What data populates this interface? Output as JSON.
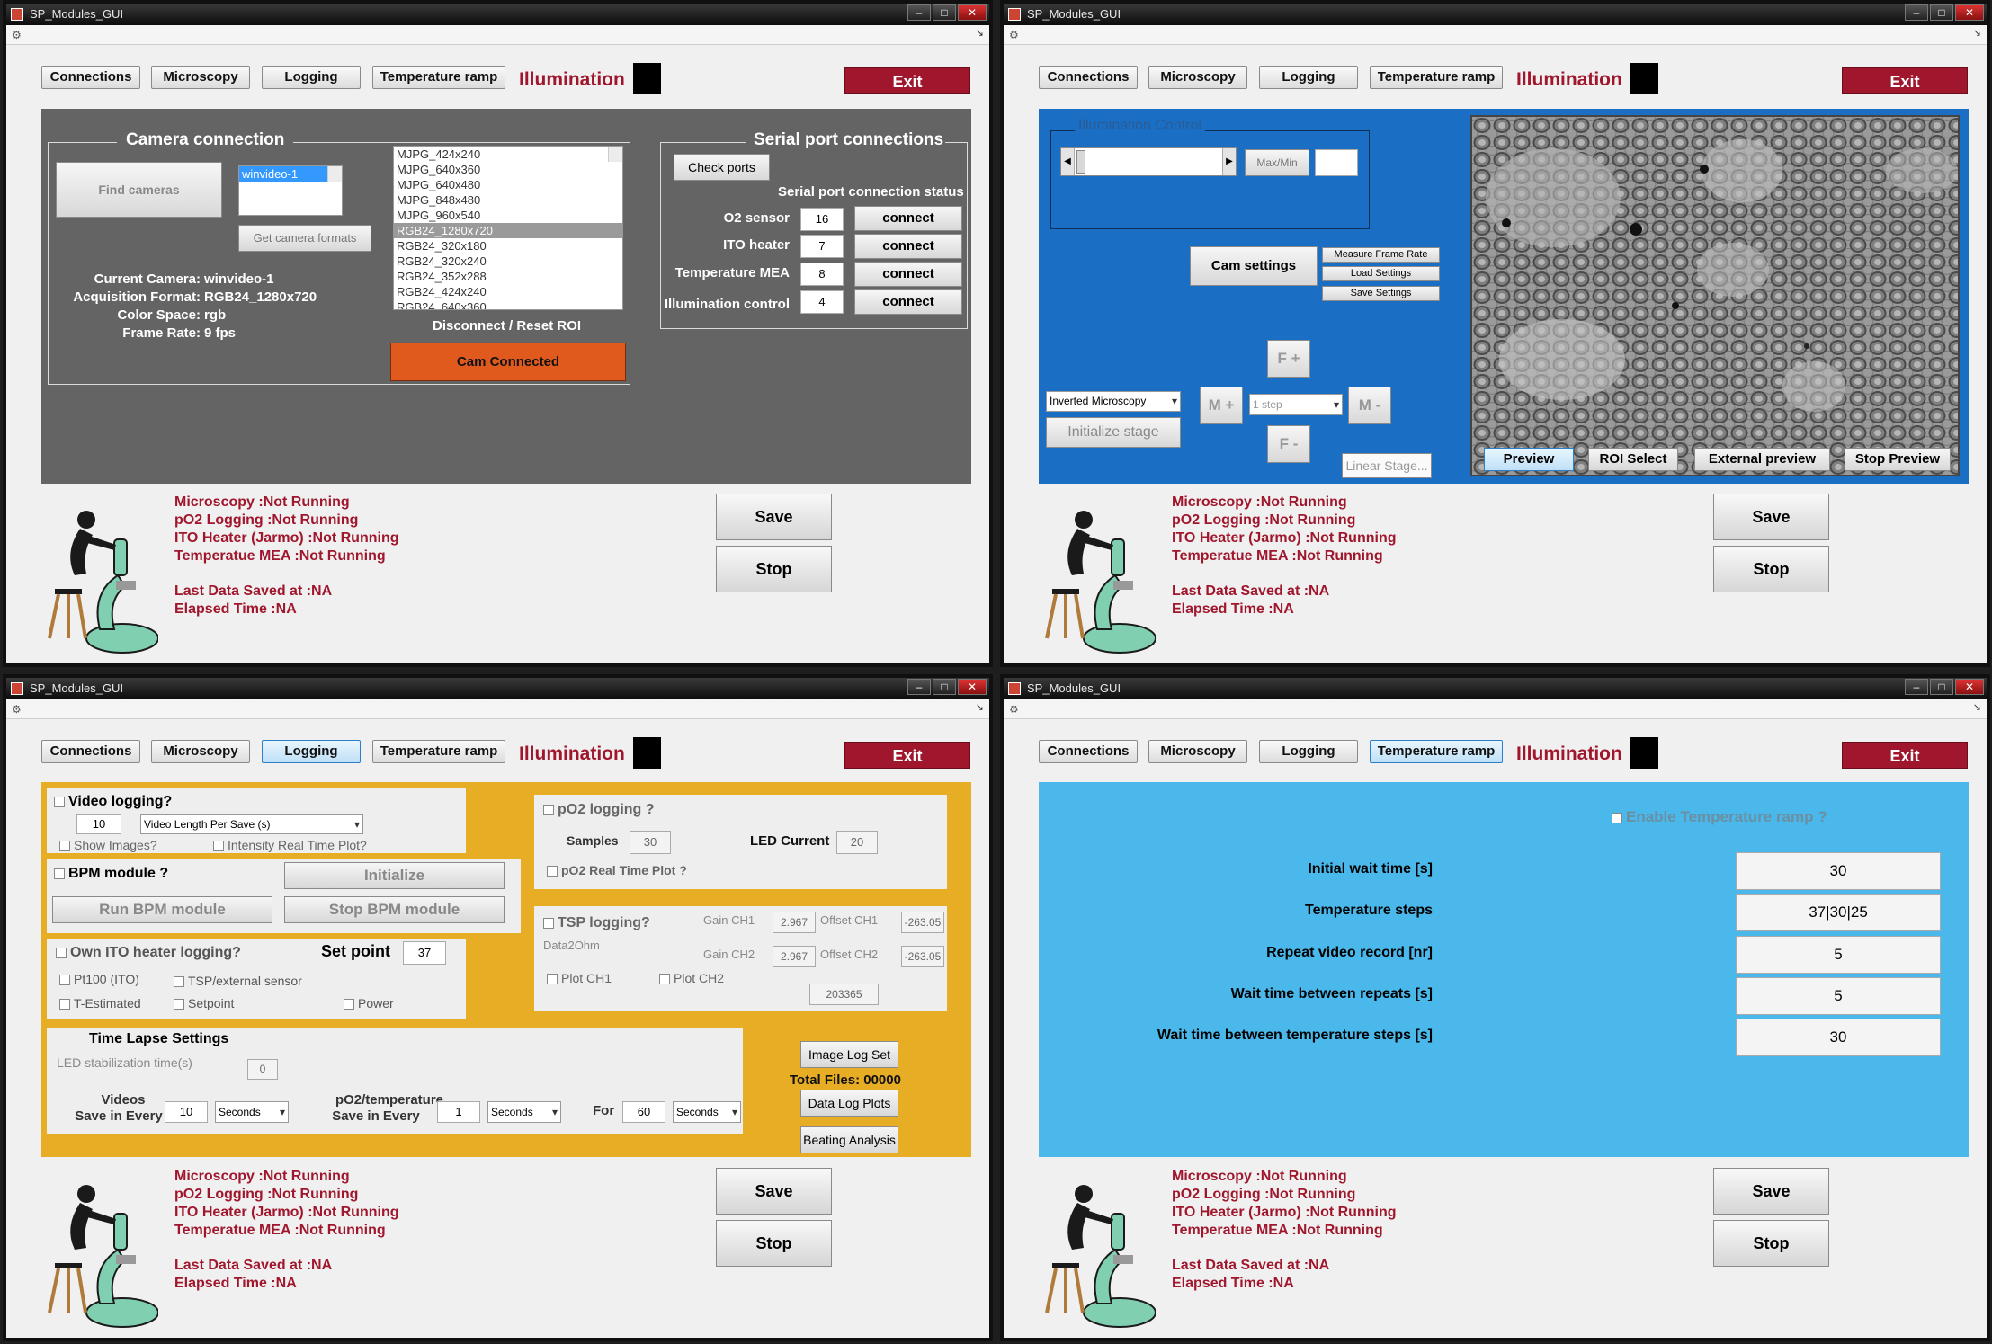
{
  "window_title": "SP_Modules_GUI",
  "tabs": {
    "connections": "Connections",
    "microscopy": "Microscopy",
    "logging": "Logging",
    "temperature_ramp": "Temperature ramp"
  },
  "illumination_label": "Illumination",
  "exit_label": "Exit",
  "status": {
    "microscopy": "Microscopy :Not Running",
    "po2": "pO2 Logging :Not Running",
    "ito": "ITO Heater (Jarmo) :Not Running",
    "mea": "Temperatue MEA :Not Running",
    "last_saved": "Last Data Saved at :NA",
    "elapsed": "Elapsed Time :NA"
  },
  "buttons": {
    "save": "Save",
    "stop": "Stop"
  },
  "connections": {
    "camera_title": "Camera connection",
    "find_cameras": "Find cameras",
    "camera_list": [
      "winvideo-1"
    ],
    "get_formats": "Get camera formats",
    "formats": [
      "MJPG_424x240",
      "MJPG_640x360",
      "MJPG_640x480",
      "MJPG_848x480",
      "MJPG_960x540",
      "RGB24_1280x720",
      "RGB24_320x180",
      "RGB24_320x240",
      "RGB24_352x288",
      "RGB24_424x240",
      "RGB24_640x360"
    ],
    "selected_format_index": 5,
    "current_camera_label": "Current Camera:",
    "current_camera": "winvideo-1",
    "acq_format_label": "Acquisition Format:",
    "acq_format": "RGB24_1280x720",
    "color_space_label": "Color Space:",
    "color_space": "rgb",
    "frame_rate_label": "Frame Rate:",
    "frame_rate": "9 fps",
    "disconnect_label": "Disconnect / Reset ROI",
    "cam_connected": "Cam Connected",
    "serial_title": "Serial port connections",
    "check_ports": "Check ports",
    "serial_status": "Serial port connection status",
    "ports": [
      {
        "name": "O2 sensor",
        "port": "16",
        "button": "connect"
      },
      {
        "name": "ITO heater",
        "port": "7",
        "button": "connect"
      },
      {
        "name": "Temperature MEA",
        "port": "8",
        "button": "connect"
      },
      {
        "name": "Illumination control",
        "port": "4",
        "button": "connect"
      }
    ],
    "accent": "#e05a1e"
  },
  "microscopy": {
    "illum_control_title": "Illumination Control",
    "maxmin": "Max/Min",
    "cam_settings": "Cam settings",
    "measure_frame_rate": "Measure Frame Rate",
    "load_settings": "Load Settings",
    "save_settings": "Save Settings",
    "f_plus": "F +",
    "f_minus": "F -",
    "m_plus": "M +",
    "m_minus": "M -",
    "step_select": "1 step",
    "mode_select": "Inverted Microscopy",
    "initialize_stage": "Initialize stage",
    "linear_stage": "Linear Stage...",
    "preview": "Preview",
    "roi_select": "ROI Select",
    "external_preview": "External preview",
    "stop_preview": "Stop Preview"
  },
  "logging": {
    "video_logging": "Video logging?",
    "video_length_value": "10",
    "video_length_select": "Video Length Per Save (s)",
    "show_images": "Show Images?",
    "intensity_plot": "Intensity Real Time Plot?",
    "bpm_module": "BPM module ?",
    "initialize": "Initialize",
    "run_bpm": "Run BPM module",
    "stop_bpm": "Stop BPM module",
    "own_ito": "Own ITO heater logging?",
    "set_point_label": "Set point",
    "set_point_value": "37",
    "pt100": "Pt100 (ITO)",
    "tsp_external": "TSP/external sensor",
    "t_estimated": "T-Estimated",
    "setpoint": "Setpoint",
    "power": "Power",
    "po2_logging": "pO2 logging ?",
    "samples_label": "Samples",
    "samples_value": "30",
    "led_current_label": "LED Current",
    "led_current_value": "20",
    "po2_realtime": "pO2 Real Time Plot ?",
    "tsp_logging": "TSP logging?",
    "gain_ch1_label": "Gain CH1",
    "gain_ch1": "2.967",
    "offset_ch1_label": "Offset CH1",
    "offset_ch1": "-263.05",
    "data2ohm": "Data2Ohm",
    "gain_ch2_label": "Gain CH2",
    "gain_ch2": "2.967",
    "offset_ch2_label": "Offset CH2",
    "offset_ch2": "-263.05",
    "plot_ch1": "Plot CH1",
    "plot_ch2": "Plot CH2",
    "tsp_value": "203365",
    "time_lapse_title": "Time Lapse Settings",
    "led_stab_label": "LED stabilization time(s)",
    "led_stab_value": "0",
    "videos_label": "Videos",
    "save_every_label": "Save in Every",
    "videos_every": "10",
    "videos_unit": "Seconds",
    "po2temp_label": "pO2/temperature",
    "po2temp_every": "1",
    "po2temp_unit": "Seconds",
    "for_label": "For",
    "for_value": "60",
    "for_unit": "Seconds",
    "image_log_set": "Image Log Set",
    "total_files": "Total Files: 00000",
    "data_log_plots": "Data Log Plots",
    "beating_analysis": "Beating Analysis"
  },
  "temperature_ramp": {
    "enable": "Enable Temperature ramp ?",
    "rows": [
      {
        "label": "Initial wait time [s]",
        "value": "30"
      },
      {
        "label": "Temperature steps",
        "value": "37|30|25"
      },
      {
        "label": "Repeat video record [nr]",
        "value": "5"
      },
      {
        "label": "Wait time between repeats [s]",
        "value": "5"
      },
      {
        "label": "Wait time between temperature steps [s]",
        "value": "30"
      }
    ]
  }
}
